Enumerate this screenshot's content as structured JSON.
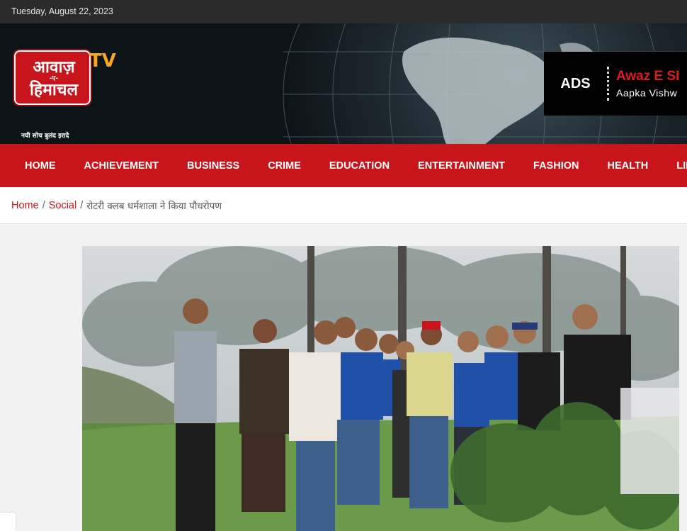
{
  "topbar": {
    "date": "Tuesday, August 22, 2023"
  },
  "logo": {
    "line1": "आवाज़",
    "line2": "-ए-",
    "line3": "हिमाचल",
    "tv": "TV",
    "tagline": "नयी सोच बुलंद इरादे"
  },
  "ad": {
    "label": "ADS",
    "title": "Awaz E SI",
    "subtitle": "Aapka Vishw"
  },
  "nav": {
    "items": [
      "HOME",
      "ACHIEVEMENT",
      "BUSINESS",
      "CRIME",
      "EDUCATION",
      "ENTERTAINMENT",
      "FASHION",
      "HEALTH",
      "LIFES"
    ]
  },
  "breadcrumb": {
    "home": "Home",
    "sep1": "/",
    "category": "Social",
    "sep2": "/",
    "current": "रोटरी क्लब धर्मशाला ने किया पौधरोपण"
  },
  "colors": {
    "brand_red": "#c8151c",
    "dark_header": "#0d1418",
    "topbar": "#2b2b2b"
  },
  "icons": {
    "ad_divider": "dotted-divider"
  }
}
